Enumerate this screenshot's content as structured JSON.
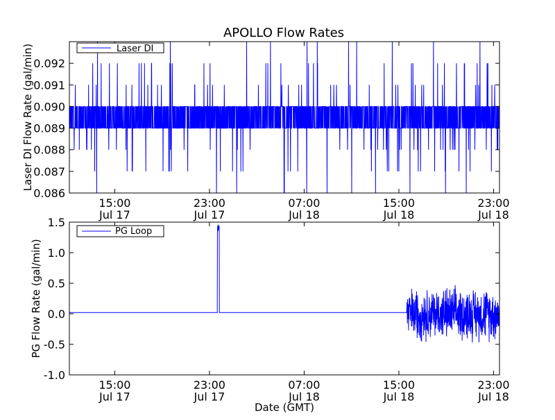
{
  "chart_data": [
    {
      "type": "line",
      "title": "APOLLO Flow Rates",
      "xlabel": "",
      "ylabel": "Laser DI Flow Rate (gal/min)",
      "ylim": [
        0.086,
        0.093
      ],
      "xlim": [
        "2012-07-17 11:10",
        "2012-07-18 23:30"
      ],
      "x_ticks": [
        {
          "time": "2012-07-17 15:00",
          "label": [
            "15:00",
            "Jul 17"
          ]
        },
        {
          "time": "2012-07-17 23:00",
          "label": [
            "23:00",
            "Jul 17"
          ]
        },
        {
          "time": "2012-07-18 07:00",
          "label": [
            "07:00",
            "Jul 18"
          ]
        },
        {
          "time": "2012-07-18 15:00",
          "label": [
            "15:00",
            "Jul 18"
          ]
        },
        {
          "time": "2012-07-18 23:00",
          "label": [
            "23:00",
            "Jul 18"
          ]
        }
      ],
      "y_ticks": [
        0.086,
        0.087,
        0.088,
        0.089,
        0.09,
        0.091,
        0.092
      ],
      "y_tick_labels": [
        "0.086",
        "0.087",
        "0.088",
        "0.089",
        "0.090",
        "0.091",
        "0.092"
      ],
      "series": [
        {
          "name": "Laser DI",
          "color": "#0000ff",
          "baseline_band": [
            0.089,
            0.09
          ],
          "spike_levels": [
            0.086,
            0.087,
            0.088,
            0.091,
            0.092,
            0.093
          ],
          "note_values": "dense quantized signal mostly between 0.089 and 0.090 gal/min with frequent excursions"
        }
      ],
      "legend": {
        "placement": "top-left"
      },
      "grid": false
    },
    {
      "type": "line",
      "title": "",
      "xlabel": "Date (GMT)",
      "ylabel": "PG Flow Rate (gal/min)",
      "ylim": [
        -1.0,
        1.5
      ],
      "xlim": [
        "2012-07-17 11:10",
        "2012-07-18 23:30"
      ],
      "x_ticks": [
        {
          "time": "2012-07-17 15:00",
          "label": [
            "15:00",
            "Jul 17"
          ]
        },
        {
          "time": "2012-07-17 23:00",
          "label": [
            "23:00",
            "Jul 17"
          ]
        },
        {
          "time": "2012-07-18 07:00",
          "label": [
            "07:00",
            "Jul 18"
          ]
        },
        {
          "time": "2012-07-18 15:00",
          "label": [
            "15:00",
            "Jul 18"
          ]
        },
        {
          "time": "2012-07-18 23:00",
          "label": [
            "23:00",
            "Jul 18"
          ]
        }
      ],
      "y_ticks": [
        -1.0,
        -0.5,
        0.0,
        0.5,
        1.0,
        1.5
      ],
      "y_tick_labels": [
        "-1.0",
        "-0.5",
        "0.0",
        "0.5",
        "1.0",
        "1.5"
      ],
      "series": [
        {
          "name": "PG Loop",
          "color": "#0000ff",
          "baseline": 0.02,
          "spike": {
            "start": "2012-07-17 23:40",
            "end": "2012-07-17 23:50",
            "peak": 1.45
          },
          "noisy_segment": {
            "start": "2012-07-18 15:40",
            "end": "2012-07-18 23:30",
            "min": -0.55,
            "max": 0.5
          }
        }
      ],
      "legend": {
        "placement": "top-left"
      },
      "grid": false
    }
  ]
}
